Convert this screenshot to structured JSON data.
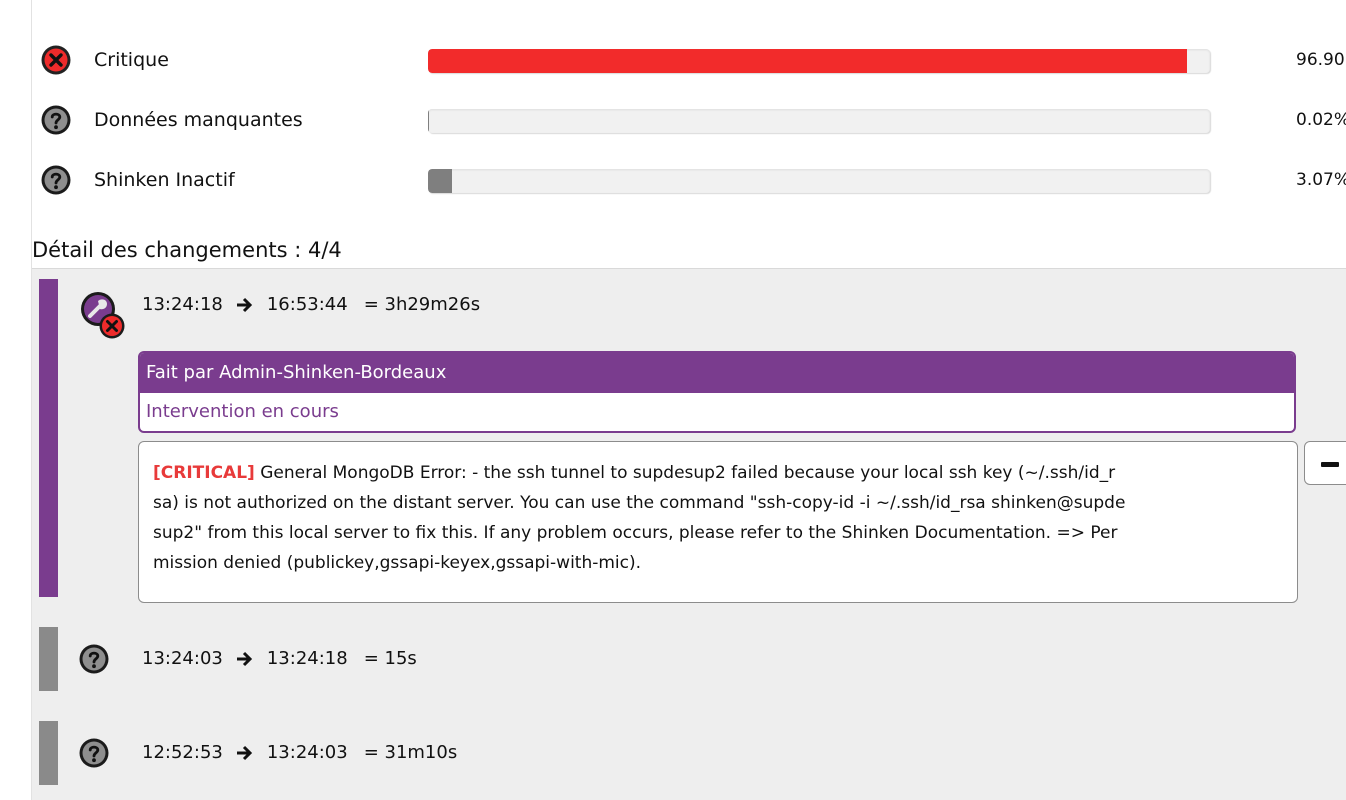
{
  "colors": {
    "critical": "#f22b2b",
    "missing": "#7f7f7f",
    "inactive": "#7f7f7f",
    "acknowledge": "#7a3c8e",
    "critical_tag": "#e83a3a"
  },
  "stats": [
    {
      "icon": "critical-icon",
      "label": "Critique",
      "percent_text": "96.90",
      "fill_fraction": 0.97,
      "fill_color": "#f22b2b"
    },
    {
      "icon": "unknown-icon",
      "label": "Données manquantes",
      "percent_text": "0.02%",
      "fill_fraction": 0.0002,
      "fill_color": "#7f7f7f"
    },
    {
      "icon": "unknown-icon",
      "label": "Shinken Inactif",
      "percent_text": "3.07%",
      "fill_fraction": 0.031,
      "fill_color": "#7f7f7f"
    }
  ],
  "changes_title": "Détail des changements : 4/4",
  "changes": [
    {
      "icon": "acknowledged-critical-icon",
      "bar_color": "#7a3c8e",
      "start": "13:24:18",
      "end": "16:53:44",
      "duration": "= 3h29m26s",
      "acknowledge": {
        "by": "Fait par Admin-Shinken-Bordeaux",
        "comment": "Intervention en cours"
      },
      "output": {
        "tag": "[CRITICAL]",
        "lines": [
          " General MongoDB Error: - the ssh tunnel to supdesup2 failed because your local ssh key (~/.ssh/id_r",
          "sa) is not authorized on the distant server. You can use the command \"ssh-copy-id -i ~/.ssh/id_rsa shinken@supde",
          "sup2\" from this local server to fix this. If any problem occurs, please refer to the Shinken Documentation. => Per",
          "mission denied (publickey,gssapi-keyex,gssapi-with-mic)."
        ]
      },
      "collapse_icon": "minus-icon"
    },
    {
      "icon": "unknown-icon",
      "bar_color": "#8a8a8a",
      "start": "13:24:03",
      "end": "13:24:18",
      "duration": "= 15s"
    },
    {
      "icon": "unknown-icon",
      "bar_color": "#8a8a8a",
      "start": "12:52:53",
      "end": "13:24:03",
      "duration": "= 31m10s"
    }
  ]
}
